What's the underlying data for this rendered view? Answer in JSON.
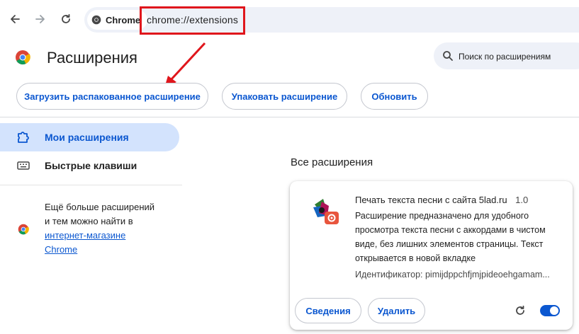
{
  "browser": {
    "chip_label": "Chrome",
    "url": "chrome://extensions"
  },
  "header": {
    "title": "Расширения",
    "search_placeholder": "Поиск по расширениям"
  },
  "actions": {
    "load_unpacked": "Загрузить распакованное расширение",
    "pack": "Упаковать расширение",
    "update": "Обновить"
  },
  "sidebar": {
    "items": [
      {
        "label": "Мои расширения",
        "active": true
      },
      {
        "label": "Быстрые клавиши",
        "active": false
      }
    ],
    "more_line1": "Ещё больше расширений",
    "more_line2": "и тем можно найти в",
    "more_link_line1": "интернет-магазине",
    "more_link_line2": "Chrome"
  },
  "main": {
    "section_title": "Все расширения",
    "extension": {
      "name": "Печать текста песни с сайта 5lad.ru",
      "version": "1.0",
      "description": "Расширение предназначено для удобного просмотра текста песни с аккордами в чистом виде, без лишних элементов страницы. Текст открывается в новой вкладке",
      "id_label": "Идентификатор: pimijdppchfjmjpideoehgamam...",
      "details_button": "Сведения",
      "remove_button": "Удалить",
      "enabled": true
    }
  },
  "colors": {
    "accent": "#0b57d0",
    "annotation": "#e0161c",
    "active_nav": "#d3e3fd"
  }
}
